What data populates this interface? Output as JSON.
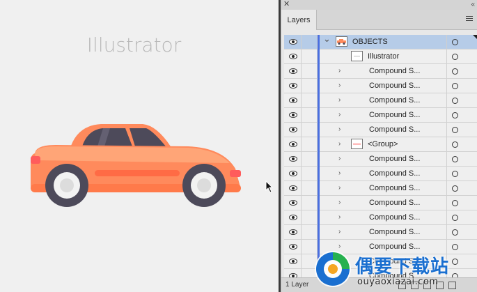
{
  "canvas": {
    "document_title": "Illustrator"
  },
  "panel": {
    "tab_label": "Layers",
    "footer_count": "1 Layer",
    "rows": [
      {
        "label": "OBJECTS",
        "indent": 0,
        "expanded": true,
        "thumb": "car",
        "selected": true
      },
      {
        "label": "Illustrator",
        "indent": 1,
        "expanded": null,
        "thumb": "text",
        "selected": false
      },
      {
        "label": "Compound S...",
        "indent": 1,
        "expanded": false,
        "thumb": null,
        "selected": false
      },
      {
        "label": "Compound S...",
        "indent": 1,
        "expanded": false,
        "thumb": null,
        "selected": false
      },
      {
        "label": "Compound S...",
        "indent": 1,
        "expanded": false,
        "thumb": null,
        "selected": false
      },
      {
        "label": "Compound S...",
        "indent": 1,
        "expanded": false,
        "thumb": null,
        "selected": false
      },
      {
        "label": "Compound S...",
        "indent": 1,
        "expanded": false,
        "thumb": null,
        "selected": false
      },
      {
        "label": "<Group>",
        "indent": 1,
        "expanded": false,
        "thumb": "group",
        "selected": false
      },
      {
        "label": "Compound S...",
        "indent": 1,
        "expanded": false,
        "thumb": null,
        "selected": false
      },
      {
        "label": "Compound S...",
        "indent": 1,
        "expanded": false,
        "thumb": null,
        "selected": false
      },
      {
        "label": "Compound S...",
        "indent": 1,
        "expanded": false,
        "thumb": null,
        "selected": false
      },
      {
        "label": "Compound S...",
        "indent": 1,
        "expanded": false,
        "thumb": null,
        "selected": false
      },
      {
        "label": "Compound S...",
        "indent": 1,
        "expanded": false,
        "thumb": null,
        "selected": false
      },
      {
        "label": "Compound S...",
        "indent": 1,
        "expanded": false,
        "thumb": null,
        "selected": false
      },
      {
        "label": "Compound S...",
        "indent": 1,
        "expanded": false,
        "thumb": null,
        "selected": false
      },
      {
        "label": "Compound S...",
        "indent": 1,
        "expanded": false,
        "thumb": null,
        "selected": false
      },
      {
        "label": "Compound S...",
        "indent": 1,
        "expanded": false,
        "thumb": null,
        "selected": false
      }
    ]
  },
  "watermark": {
    "brand": "偶要下载站",
    "url": "ouyaoxiazai.com"
  },
  "colors": {
    "layer_color": "#4a6fe0",
    "selected_row": "#b6cce8",
    "car_body": "#ff8a5c",
    "car_window": "#4d4a5a",
    "watermark_blue": "#1a6fd0"
  }
}
